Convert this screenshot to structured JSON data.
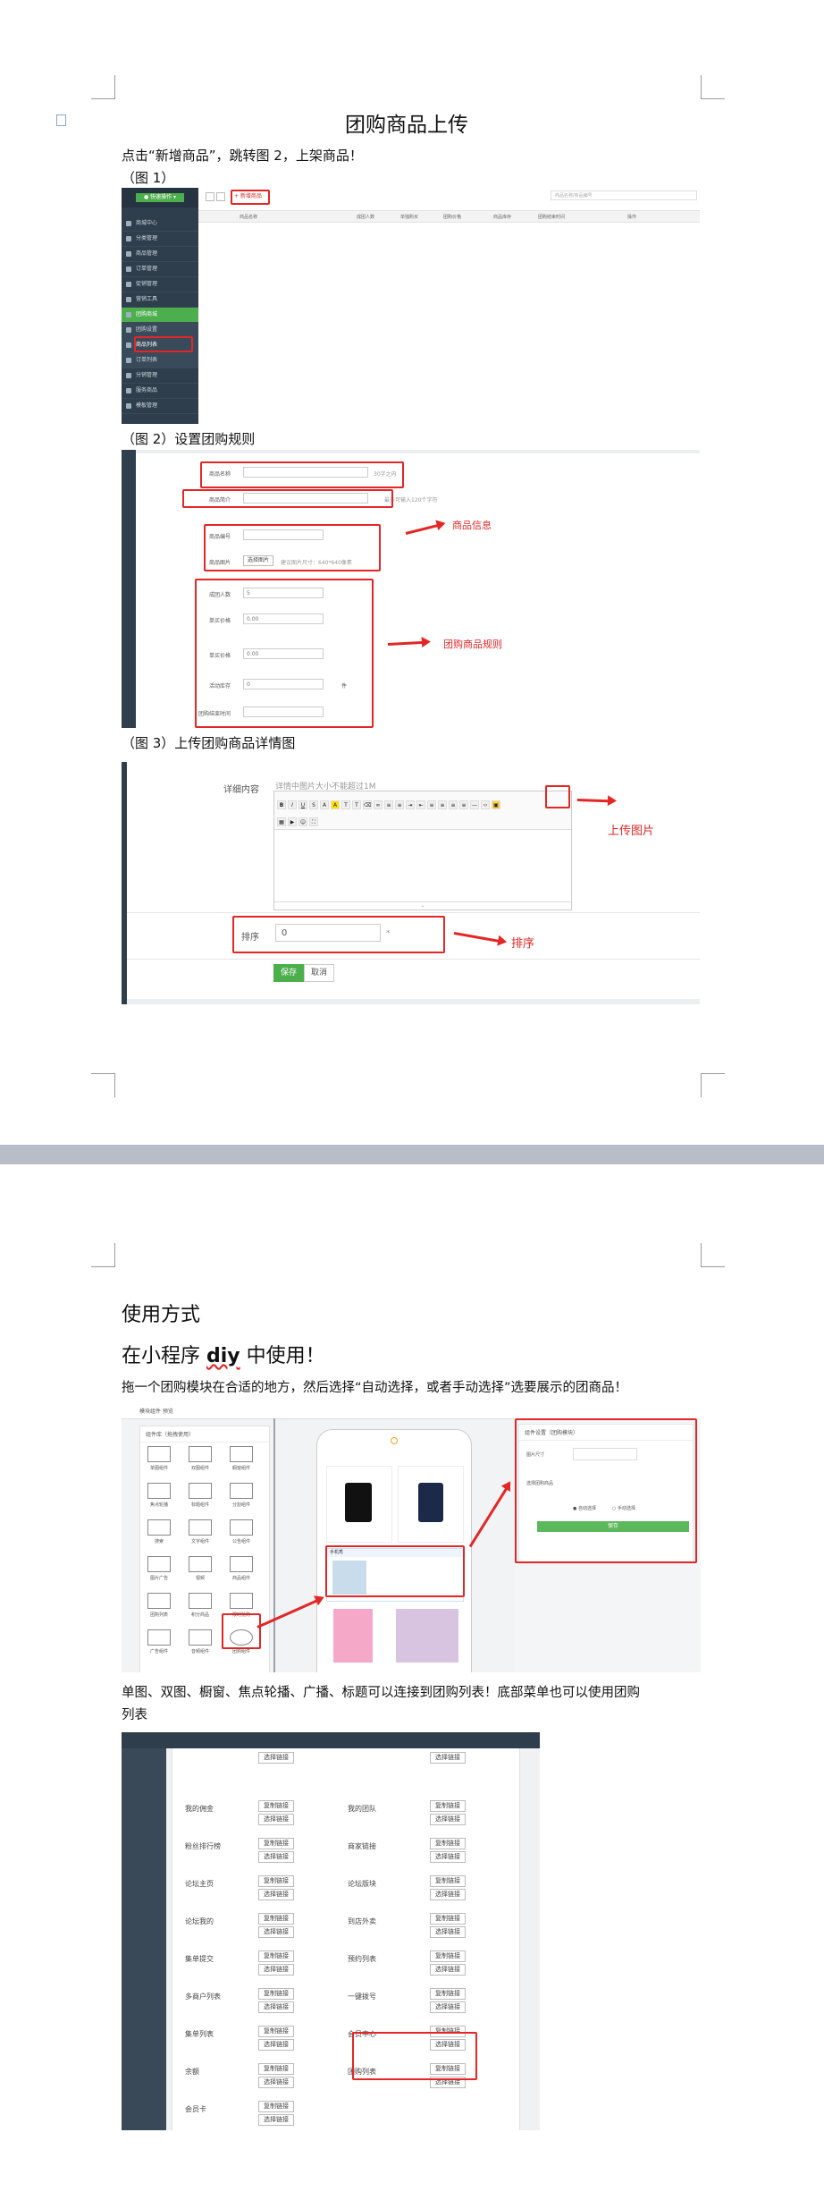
{
  "page1": {
    "title": "团购商品上传",
    "intro": "点击“新增商品”，跳转图 2，上架商品！",
    "fig1_caption": "（图 1）",
    "fig2_caption": "（图 2）设置团购规则",
    "fig3_caption": "（图 3）上传团购商品详情图"
  },
  "fig1": {
    "add_button": "+ 新增商品",
    "green_button": "● 快速操作 ▾",
    "search_placeholder": "商品名称/商品编号",
    "columns": [
      "商品名称",
      "成团人数",
      "单独购买",
      "团购价格",
      "商品库存",
      "团购结束时间",
      "操作"
    ],
    "sidebar": [
      "商城中心",
      "分类管理",
      "商品管理",
      "订单管理",
      "促销管理",
      "营销工具",
      "团购商城",
      "团购设置",
      "商品列表",
      "订单列表",
      "分销管理",
      "服务商品",
      "模板管理"
    ]
  },
  "fig2": {
    "rows": [
      {
        "label": "商品名称",
        "hint": "30字之内"
      },
      {
        "label": "商品简介",
        "hint": "最多可输入120个字符"
      },
      {
        "label": "商品编号",
        "hint": ""
      },
      {
        "label": "商品图片",
        "hint": "建议图片尺寸：640*640像素",
        "button": "选择图片"
      },
      {
        "label": "成团人数",
        "value": "5"
      },
      {
        "label": "单买价格",
        "value": "0.00"
      },
      {
        "label": "单买价格",
        "value": "0.00"
      },
      {
        "label": "活动库存",
        "value": "0",
        "unit": "件"
      },
      {
        "label": "团购结束时间",
        "value": ""
      }
    ],
    "annotation_goods": "商品信息",
    "annotation_rules": "团购商品规则"
  },
  "fig3": {
    "detail_label": "详细内容",
    "detail_hint": "详情中图片大小不能超过1M",
    "sort_label": "排序",
    "sort_value": "0",
    "save_button": "保存",
    "cancel_button": "取消",
    "annotation_upload": "上传图片",
    "annotation_sort": "排序"
  },
  "page2": {
    "heading": "使用方式",
    "subheading_pre": "在小程序 ",
    "subheading_word": "diy",
    "subheading_post": " 中使用！",
    "desc": "拖一个团购模块在合适的地方，然后选择“自动选择，或者手动选择”选要展示的团商品！",
    "desc2_line1": "单图、双图、橱窗、焦点轮播、广播、标题可以连接到团购列表！底部菜单也可以使用团购",
    "desc2_line2": "列表"
  },
  "diy": {
    "top_label": "模块组件 预览",
    "panel_title": "组件库（拖拽使用）",
    "modules": [
      "单图组件",
      "双图组件",
      "橱窗组件",
      "焦点轮播",
      "标题组件",
      "分割组件",
      "搜索",
      "文字组件",
      "公告组件",
      "图片广告",
      "视频",
      "商品组件",
      "团购列表",
      "积分商品",
      "限时抢购",
      "广告组件",
      "音频组件",
      "团购组件"
    ],
    "phone_item_title": "手机秀",
    "right_title": "组件设置（团购模块）",
    "right_labels": [
      "图片尺寸",
      "选择团购商品"
    ],
    "auto_select": "自动选择",
    "manual_select": "手动选择",
    "save": "保存"
  },
  "links": {
    "rows": [
      {
        "left": "",
        "right": ""
      },
      {
        "left": "我的佣金",
        "right": "我的团队"
      },
      {
        "left": "粉丝排行榜",
        "right": "商家链接"
      },
      {
        "left": "论坛主页",
        "right": "论坛版块"
      },
      {
        "left": "论坛我的",
        "right": "到店外卖"
      },
      {
        "left": "集单提交",
        "right": "预约列表"
      },
      {
        "left": "多商户列表",
        "right": "一键拨号"
      },
      {
        "left": "集单列表",
        "right": "会员中心"
      },
      {
        "left": "余额",
        "right": "团购列表"
      },
      {
        "left": "会员卡",
        "right": ""
      }
    ],
    "copy_btn": "复制链接",
    "select_btn": "选择链接"
  },
  "colors": {
    "red": "#e32626",
    "sidebar": "#2f3e4c",
    "green": "#4cae4c"
  }
}
